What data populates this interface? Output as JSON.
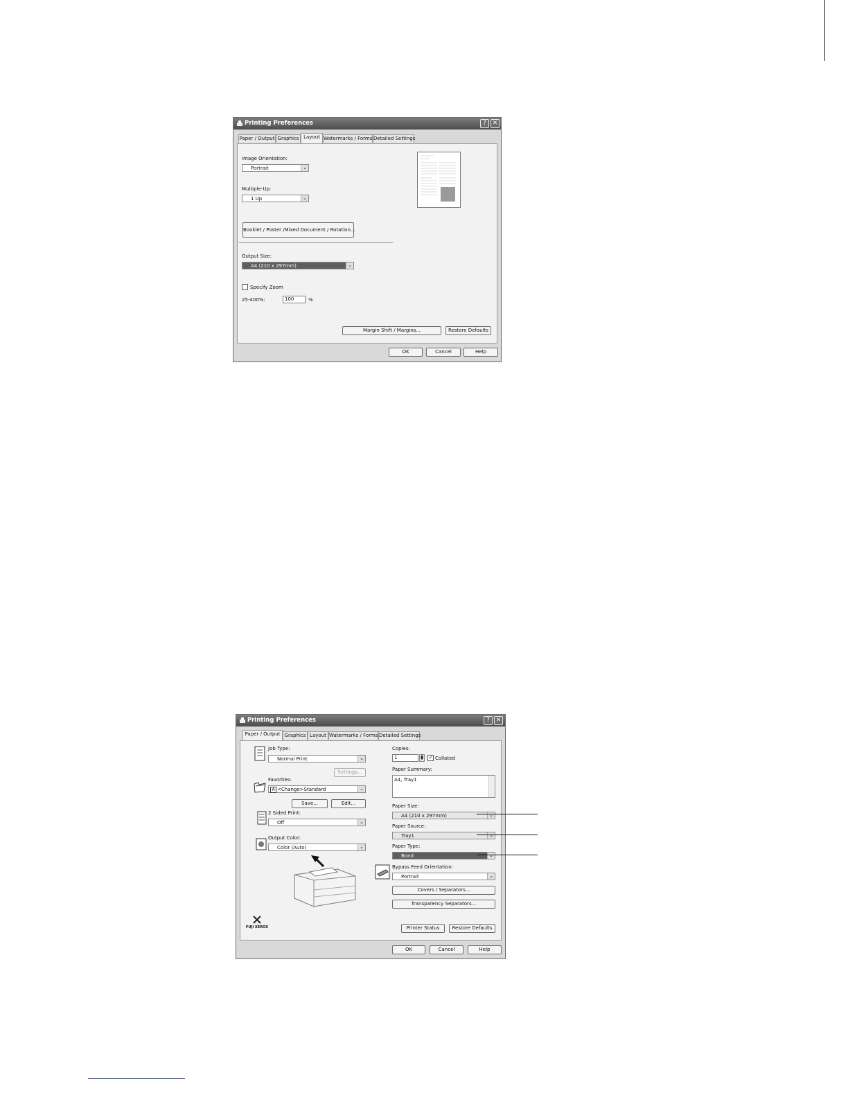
{
  "dialog1": {
    "title": "Printing Preferences",
    "help_button": "?",
    "close_button": "✕",
    "tabs": [
      "Paper / Output",
      "Graphics",
      "Layout",
      "Watermarks / Forms",
      "Detailed Settings"
    ],
    "active_tab": "Layout",
    "image_orientation": {
      "label": "Image Orientation:",
      "value": "Portrait"
    },
    "multiple_up": {
      "label": "Multiple-Up:",
      "value": "1 Up"
    },
    "booklet_button": "Booklet / Poster /Mixed Document / Rotation...",
    "output_size": {
      "label": "Output Size:",
      "value": "A4 (210 x 297mm)"
    },
    "specify_zoom": {
      "label": "Specify Zoom",
      "checked": false
    },
    "zoom": {
      "label": "25-400%:",
      "value": "100",
      "unit": "%"
    },
    "margin_button": "Margin Shift / Margins...",
    "restore_button": "Restore Defaults",
    "ok": "OK",
    "cancel": "Cancel",
    "help": "Help"
  },
  "dialog2": {
    "title": "Printing Preferences",
    "help_button": "?",
    "close_button": "✕",
    "tabs": [
      "Paper / Output",
      "Graphics",
      "Layout",
      "Watermarks / Forms",
      "Detailed Settings"
    ],
    "active_tab": "Paper / Output",
    "job_type": {
      "label": "Job Type:",
      "value": "Normal Print"
    },
    "settings_button": "Settings...",
    "favorites": {
      "label": "Favorites:",
      "value": "<Change>Standard",
      "badge": "A"
    },
    "save_button": "Save...",
    "edit_button": "Edit...",
    "two_sided": {
      "label": "2 Sided Print:",
      "value": "Off"
    },
    "output_color": {
      "label": "Output Color:",
      "value": "Color (Auto)"
    },
    "copies": {
      "label": "Copies:",
      "value": "1"
    },
    "collated": {
      "label": "Collated",
      "checked": true
    },
    "paper_summary": {
      "label": "Paper Summary:",
      "value": "A4, Tray1"
    },
    "paper_size": {
      "label": "Paper Size:",
      "value": "A4 (210 x 297mm)"
    },
    "paper_source": {
      "label": "Paper Source:",
      "value": "Tray1"
    },
    "paper_type": {
      "label": "Paper Type:",
      "value": "Bond"
    },
    "bypass_orientation": {
      "label": "Bypass Feed Orientation:",
      "value": "Portrait"
    },
    "covers_button": "Covers / Separators...",
    "transparency_button": "Transparency Separators...",
    "printer_status_button": "Printer Status",
    "restore_button": "Restore Defaults",
    "logo_mark": "X",
    "logo_text": "FUJI XEROX",
    "ok": "OK",
    "cancel": "Cancel",
    "help": "Help"
  },
  "colors": {
    "titlebar": "#5c5c5c",
    "dialog_bg": "#d9d9d9",
    "panel_bg": "#f2f2f2",
    "highlight": "#5e5e5e"
  }
}
